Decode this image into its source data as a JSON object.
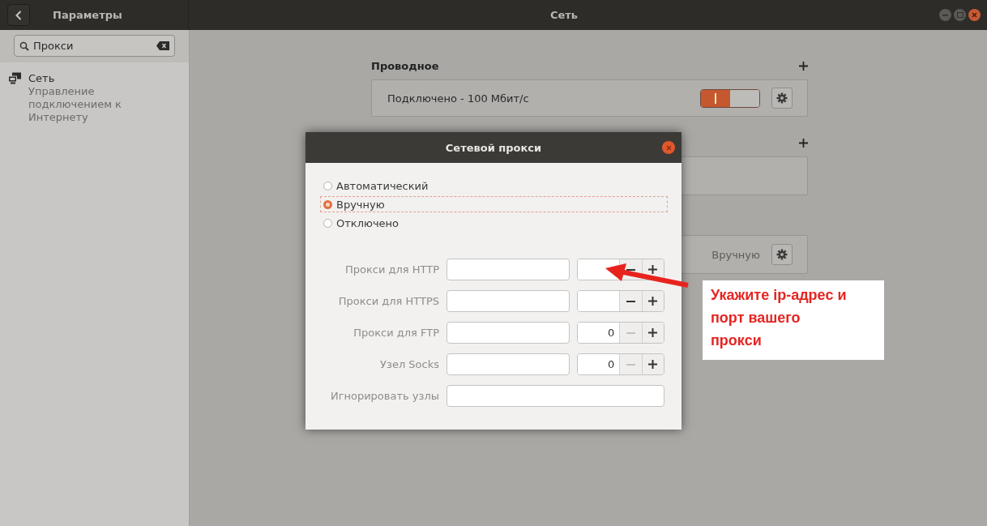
{
  "window": {
    "app_title": "Параметры",
    "title": "Сеть"
  },
  "search": {
    "value": "Прокси"
  },
  "sidebar": {
    "items": [
      {
        "title": "Сеть",
        "subtitle": "Управление подключением к Интернету",
        "selected": false
      }
    ]
  },
  "sections": [
    {
      "title": "Проводное",
      "add_button": true,
      "rows": [
        {
          "kind": "switch",
          "label": "Подключено - 100 Мбит/с",
          "on": true
        }
      ]
    },
    {
      "add_button": true,
      "rows": [
        {
          "kind": "blank"
        }
      ]
    },
    {
      "add_button": false,
      "rows": [
        {
          "kind": "status",
          "value": "Вручную"
        }
      ]
    }
  ],
  "dialog": {
    "title": "Сетевой прокси",
    "modes": [
      {
        "label": "Автоматический",
        "selected": false
      },
      {
        "label": "Вручную",
        "selected": true
      },
      {
        "label": "Отключено",
        "selected": false
      }
    ],
    "fields": [
      {
        "kind": "host_port",
        "label": "Прокси для HTTP",
        "minus_disabled": false
      },
      {
        "kind": "host_port",
        "label": "Прокси для HTTPS",
        "minus_disabled": false
      },
      {
        "kind": "host_port",
        "label": "Прокси для FTP",
        "port": "0",
        "minus_disabled": true
      },
      {
        "kind": "host_port",
        "label": "Узел Socks",
        "port": "0",
        "minus_disabled": true
      },
      {
        "kind": "text",
        "label": "Игнорировать узлы"
      }
    ]
  },
  "annotation": {
    "text": "Укажите ip-адрес и порт вашего прокси"
  }
}
